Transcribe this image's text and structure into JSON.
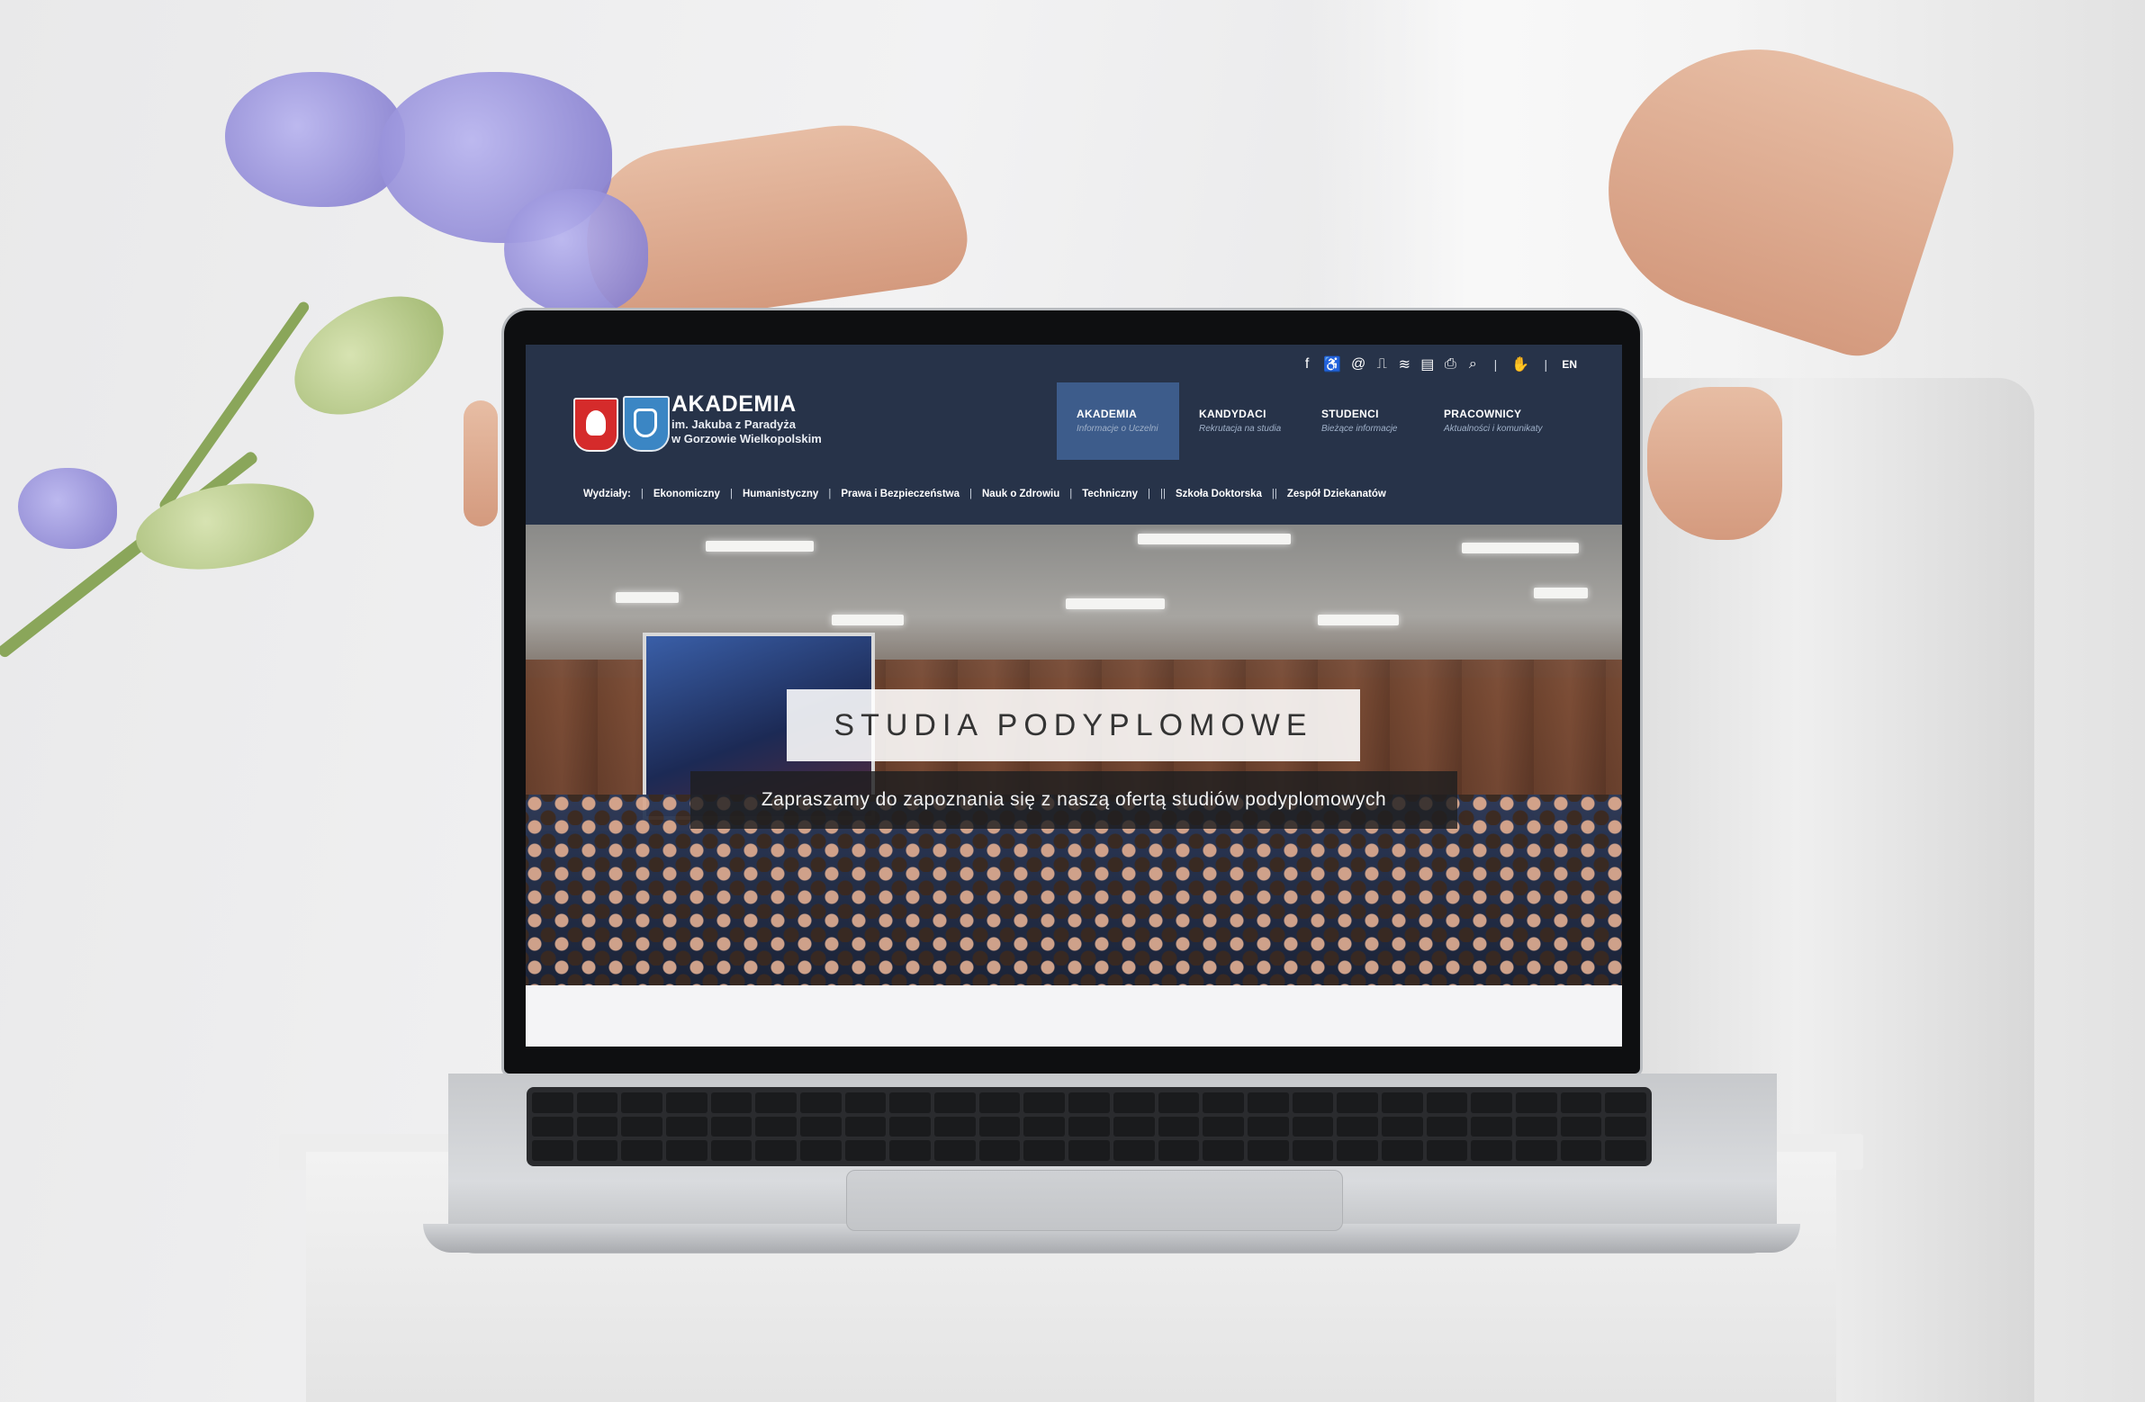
{
  "site": {
    "brand": {
      "title": "AKADEMIA",
      "line1": "im. Jakuba z Paradyża",
      "line2": "w Gorzowie Wielkopolskim"
    },
    "top_icons": [
      "facebook-icon",
      "accessibility-icon",
      "email-icon",
      "bip-icon",
      "wifi-icon",
      "document-icon",
      "print-icon",
      "search-icon",
      "sign-language-icon"
    ],
    "lang": "EN",
    "main_nav": [
      {
        "title": "AKADEMIA",
        "subtitle": "Informacje o Uczelni",
        "active": true
      },
      {
        "title": "KANDYDACI",
        "subtitle": "Rekrutacja na studia",
        "active": false
      },
      {
        "title": "STUDENCI",
        "subtitle": "Bieżące informacje",
        "active": false
      },
      {
        "title": "PRACOWNICY",
        "subtitle": "Aktualności i komunikaty",
        "active": false
      }
    ],
    "subnav": {
      "label": "Wydziały:",
      "items": [
        "Ekonomiczny",
        "Humanistyczny",
        "Prawa i Bezpieczeństwa",
        "Nauk o Zdrowiu",
        "Techniczny"
      ],
      "extra": [
        "Szkoła Doktorska",
        "Zespół Dziekanatów"
      ]
    },
    "hero": {
      "title": "STUDIA PODYPLOMOWE",
      "subtitle": "Zapraszamy do zapoznania się z naszą ofertą studiów podyplomowych"
    },
    "colors": {
      "header_bg": "#273349",
      "active_nav": "#3d5c8b"
    }
  }
}
